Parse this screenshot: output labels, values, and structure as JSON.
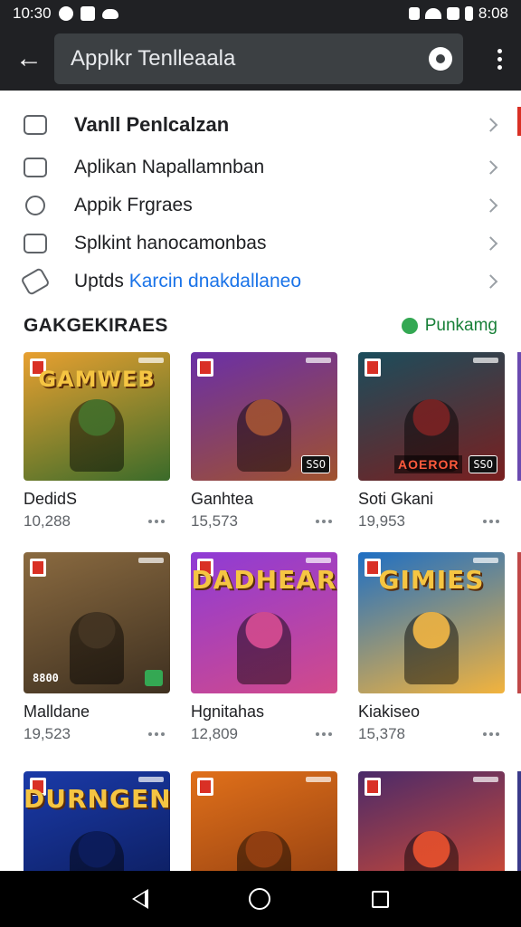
{
  "status_bar": {
    "time": "10:30",
    "right_text": "8:08"
  },
  "app_bar": {
    "search_text": "Applkr Tenlleaala",
    "icons": [
      "back-arrow-icon",
      "account-icon",
      "more-vert-icon"
    ]
  },
  "menu": {
    "items": [
      {
        "label": "Vanll Penlcalzan",
        "icon": "store-icon"
      },
      {
        "label": "Aplikan Napallamnban",
        "icon": "devices-icon"
      },
      {
        "label": "Appik Frgraes",
        "icon": "target-icon"
      },
      {
        "label": "Splkint hanocamonbas",
        "icon": "library-icon"
      },
      {
        "label_prefix": "Uptds",
        "label_accent": "Karcin dnakdallaneo",
        "icon": "tag-icon"
      }
    ]
  },
  "section": {
    "title": "GAKGEKIRAES",
    "link_label": "Punkamg"
  },
  "games": [
    {
      "thumb_title": "GAMWEB",
      "name": "DedidS",
      "count": "10,288",
      "colors": [
        "#e8a030",
        "#3a6b2a"
      ]
    },
    {
      "thumb_title": "",
      "name": "Ganhtea",
      "count": "15,573",
      "badge": "SSO",
      "colors": [
        "#6a2fa8",
        "#a0522d"
      ]
    },
    {
      "thumb_title": "",
      "name": "Soti Gkani",
      "count": "19,953",
      "banner": "AOEROR",
      "badge": "SSO",
      "colors": [
        "#1b4d5c",
        "#7a1f1f"
      ]
    },
    {
      "thumb_title": "",
      "name": "Malldane",
      "count": "19,523",
      "badge_left": "8800",
      "colors": [
        "#8a6a40",
        "#3e3020"
      ]
    },
    {
      "thumb_title": "DADHEAR",
      "name": "Hgnitahas",
      "count": "12,809",
      "colors": [
        "#8e3bd6",
        "#d24a8a"
      ]
    },
    {
      "thumb_title": "GIMIES",
      "name": "Kiakiseo",
      "count": "15,378",
      "colors": [
        "#1e6fc4",
        "#f2b33d"
      ]
    },
    {
      "thumb_title": "DURNGEN",
      "name": "",
      "count": "",
      "colors": [
        "#1a3aa8",
        "#0b1a55"
      ]
    },
    {
      "thumb_title": "",
      "name": "",
      "count": "",
      "colors": [
        "#e0701a",
        "#8a3a10"
      ]
    },
    {
      "thumb_title": "",
      "name": "",
      "count": "",
      "colors": [
        "#4a2a6a",
        "#e8502a"
      ]
    }
  ]
}
